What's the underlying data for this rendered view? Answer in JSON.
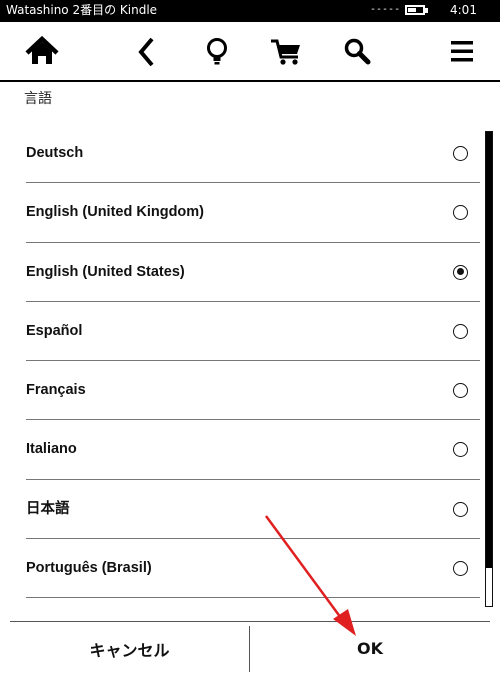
{
  "status_bar": {
    "title": "Watashino 2番目の Kindle",
    "signal": "-----",
    "battery_level": 0.55,
    "time": "4:01"
  },
  "toolbar": {
    "icons": [
      "home-icon",
      "back-icon",
      "lightbulb-icon",
      "cart-icon",
      "search-icon",
      "menu-icon"
    ]
  },
  "section": {
    "label": "言語"
  },
  "languages": [
    {
      "label": "Deutsch",
      "selected": false
    },
    {
      "label": "English (United Kingdom)",
      "selected": false
    },
    {
      "label": "English (United States)",
      "selected": true
    },
    {
      "label": "Español",
      "selected": false
    },
    {
      "label": "Français",
      "selected": false
    },
    {
      "label": "Italiano",
      "selected": false
    },
    {
      "label": "日本語",
      "selected": false
    },
    {
      "label": "Português (Brasil)",
      "selected": false
    }
  ],
  "scrollbar": {
    "visible_fraction": 0.92
  },
  "footer": {
    "cancel_label": "キャンセル",
    "ok_label": "OK"
  },
  "colors": {
    "status_bar_bg": "#000000",
    "annotation_arrow": "#e02020"
  }
}
